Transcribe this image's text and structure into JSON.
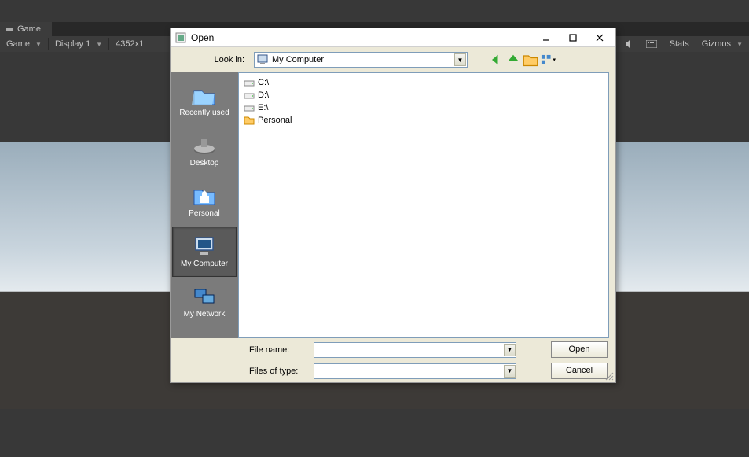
{
  "unity": {
    "tab_label": "Game",
    "toolbar": {
      "game": "Game",
      "display": "Display 1",
      "resolution": "4352x1",
      "stats": "Stats",
      "gizmos": "Gizmos"
    }
  },
  "dialog": {
    "title": "Open",
    "lookin_label": "Look in:",
    "lookin_value": "My Computer",
    "sidebar": [
      {
        "id": "recent",
        "label": "Recently used"
      },
      {
        "id": "desktop",
        "label": "Desktop"
      },
      {
        "id": "personal",
        "label": "Personal"
      },
      {
        "id": "computer",
        "label": "My Computer"
      },
      {
        "id": "network",
        "label": "My Network"
      }
    ],
    "selected_sidebar": "computer",
    "files": [
      "C:\\",
      "D:\\",
      "E:\\",
      "Personal"
    ],
    "filename_label": "File name:",
    "filename_value": "",
    "filetype_label": "Files of type:",
    "filetype_value": "",
    "open_btn": "Open",
    "cancel_btn": "Cancel"
  }
}
